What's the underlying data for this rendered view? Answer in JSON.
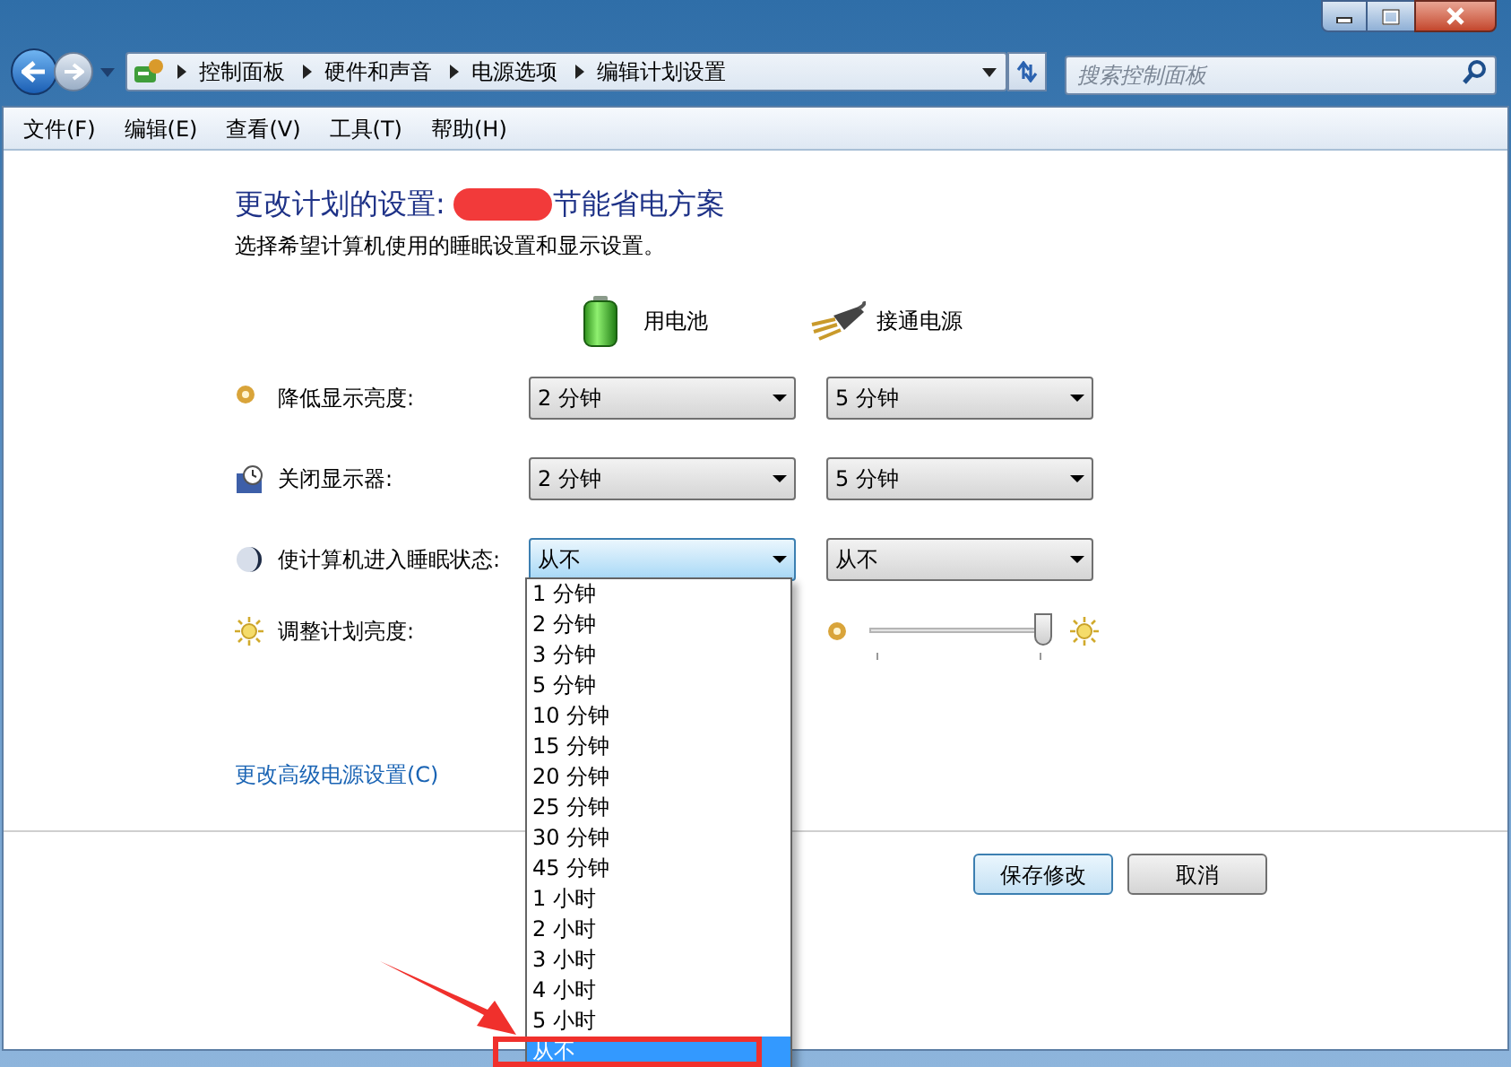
{
  "window": {
    "controls": [
      {
        "kind": "minimize"
      },
      {
        "kind": "maximize"
      },
      {
        "kind": "close"
      }
    ]
  },
  "address_bar": {
    "crumbs": [
      "控制面板",
      "硬件和声音",
      "电源选项",
      "编辑计划设置"
    ]
  },
  "search": {
    "placeholder": "搜索控制面板"
  },
  "menu": [
    "文件(F)",
    "编辑(E)",
    "查看(V)",
    "工具(T)",
    "帮助(H)"
  ],
  "heading": {
    "prefix": "更改计划的设置: ",
    "redacted": true,
    "suffix": "节能省电方案"
  },
  "subtitle": "选择希望计算机使用的睡眠设置和显示设置。",
  "columns": [
    {
      "kind": "battery",
      "label": "用电池"
    },
    {
      "kind": "plug",
      "label": "接通电源"
    }
  ],
  "settings": [
    {
      "kind": "dim",
      "label": "降低显示亮度:",
      "on_battery": {
        "value": "2 分钟",
        "expanded": false
      },
      "plugged_in": {
        "value": "5 分钟",
        "expanded": false
      }
    },
    {
      "kind": "display",
      "label": "关闭显示器:",
      "on_battery": {
        "value": "2 分钟",
        "expanded": false
      },
      "plugged_in": {
        "value": "5 分钟",
        "expanded": false
      }
    },
    {
      "kind": "sleep",
      "label": "使计算机进入睡眠状态:",
      "on_battery": {
        "value": "从不",
        "expanded": true
      },
      "plugged_in": {
        "value": "从不",
        "expanded": false
      }
    }
  ],
  "brightness": {
    "label": "调整计划亮度:",
    "plugged_in": {
      "level": 0.97
    }
  },
  "dropdown_options": [
    {
      "label": "1 分钟",
      "selected": false
    },
    {
      "label": "2 分钟",
      "selected": false
    },
    {
      "label": "3 分钟",
      "selected": false
    },
    {
      "label": "5 分钟",
      "selected": false
    },
    {
      "label": "10 分钟",
      "selected": false
    },
    {
      "label": "15 分钟",
      "selected": false
    },
    {
      "label": "20 分钟",
      "selected": false
    },
    {
      "label": "25 分钟",
      "selected": false
    },
    {
      "label": "30 分钟",
      "selected": false
    },
    {
      "label": "45 分钟",
      "selected": false
    },
    {
      "label": "1 小时",
      "selected": false
    },
    {
      "label": "2 小时",
      "selected": false
    },
    {
      "label": "3 小时",
      "selected": false
    },
    {
      "label": "4 小时",
      "selected": false
    },
    {
      "label": "5 小时",
      "selected": false
    },
    {
      "label": "从不",
      "selected": true
    }
  ],
  "advanced_link": "更改高级电源设置(C)",
  "buttons": [
    {
      "label": "保存修改",
      "default": true
    },
    {
      "label": "取消",
      "default": false
    }
  ],
  "annotation": {
    "arrow": true,
    "highlight": true
  }
}
